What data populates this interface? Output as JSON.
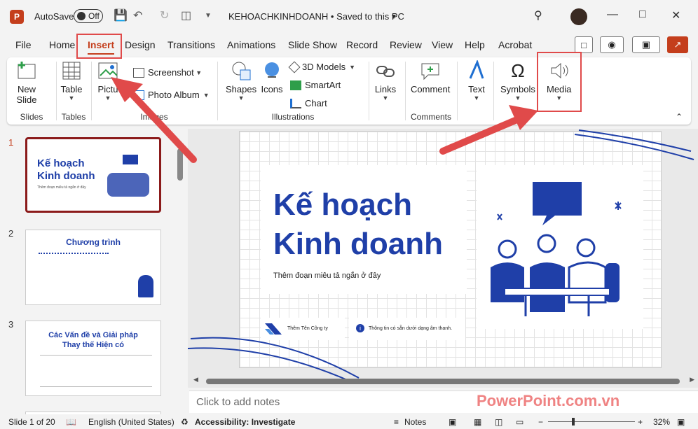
{
  "titlebar": {
    "autosave_label": "AutoSave",
    "toggle_state": "Off",
    "doc_title": "KEHOACHKINHDOANH • Saved to this PC"
  },
  "tabs": [
    "File",
    "Home",
    "Insert",
    "Design",
    "Transitions",
    "Animations",
    "Slide Show",
    "Record",
    "Review",
    "View",
    "Help",
    "Acrobat"
  ],
  "ribbon": {
    "slides": {
      "new_slide": "New",
      "new_slide2": "Slide",
      "group": "Slides"
    },
    "tables": {
      "table": "Table",
      "group": "Tables"
    },
    "images": {
      "pictures": "Pictu",
      "screenshot": "Screenshot",
      "photo_album": "Photo Album",
      "group": "Images"
    },
    "illustrations": {
      "shapes": "Shapes",
      "icons": "Icons",
      "models": "3D Models",
      "smartart": "SmartArt",
      "chart": "Chart",
      "group": "Illustrations"
    },
    "links": {
      "links": "Links"
    },
    "comments": {
      "comment": "Comment",
      "group": "Comments"
    },
    "text": {
      "text": "Text"
    },
    "symbols": {
      "symbols": "Symbols"
    },
    "media": {
      "media": "Media"
    }
  },
  "thumbs": [
    {
      "num": "1",
      "title1": "Kế hoạch",
      "title2": "Kinh doanh",
      "sub": "Thêm đoạn miêu tả ngắn ở đây"
    },
    {
      "num": "2",
      "title": "Chương trình"
    },
    {
      "num": "3",
      "title1": "Các Vấn đề và Giải pháp",
      "title2": "Thay thế Hiện có"
    }
  ],
  "slide": {
    "title1": "Kế hoạch",
    "title2": "Kinh doanh",
    "subtitle": "Thêm đoạn miêu tả ngắn ở đây",
    "company": "Thêm Tên Công ty",
    "info": "Thông tin có sẵn dưới dạng âm thanh."
  },
  "notes_placeholder": "Click to add notes",
  "watermark": "PowerPoint.com.vn",
  "status": {
    "slide": "Slide 1 of 20",
    "language": "English (United States)",
    "accessibility": "Accessibility: Investigate",
    "notes": "Notes",
    "zoom": "32%"
  },
  "colors": {
    "accent": "#c43e1c",
    "slide_blue": "#1f3fa8",
    "annotation_red": "#e04a4a"
  }
}
